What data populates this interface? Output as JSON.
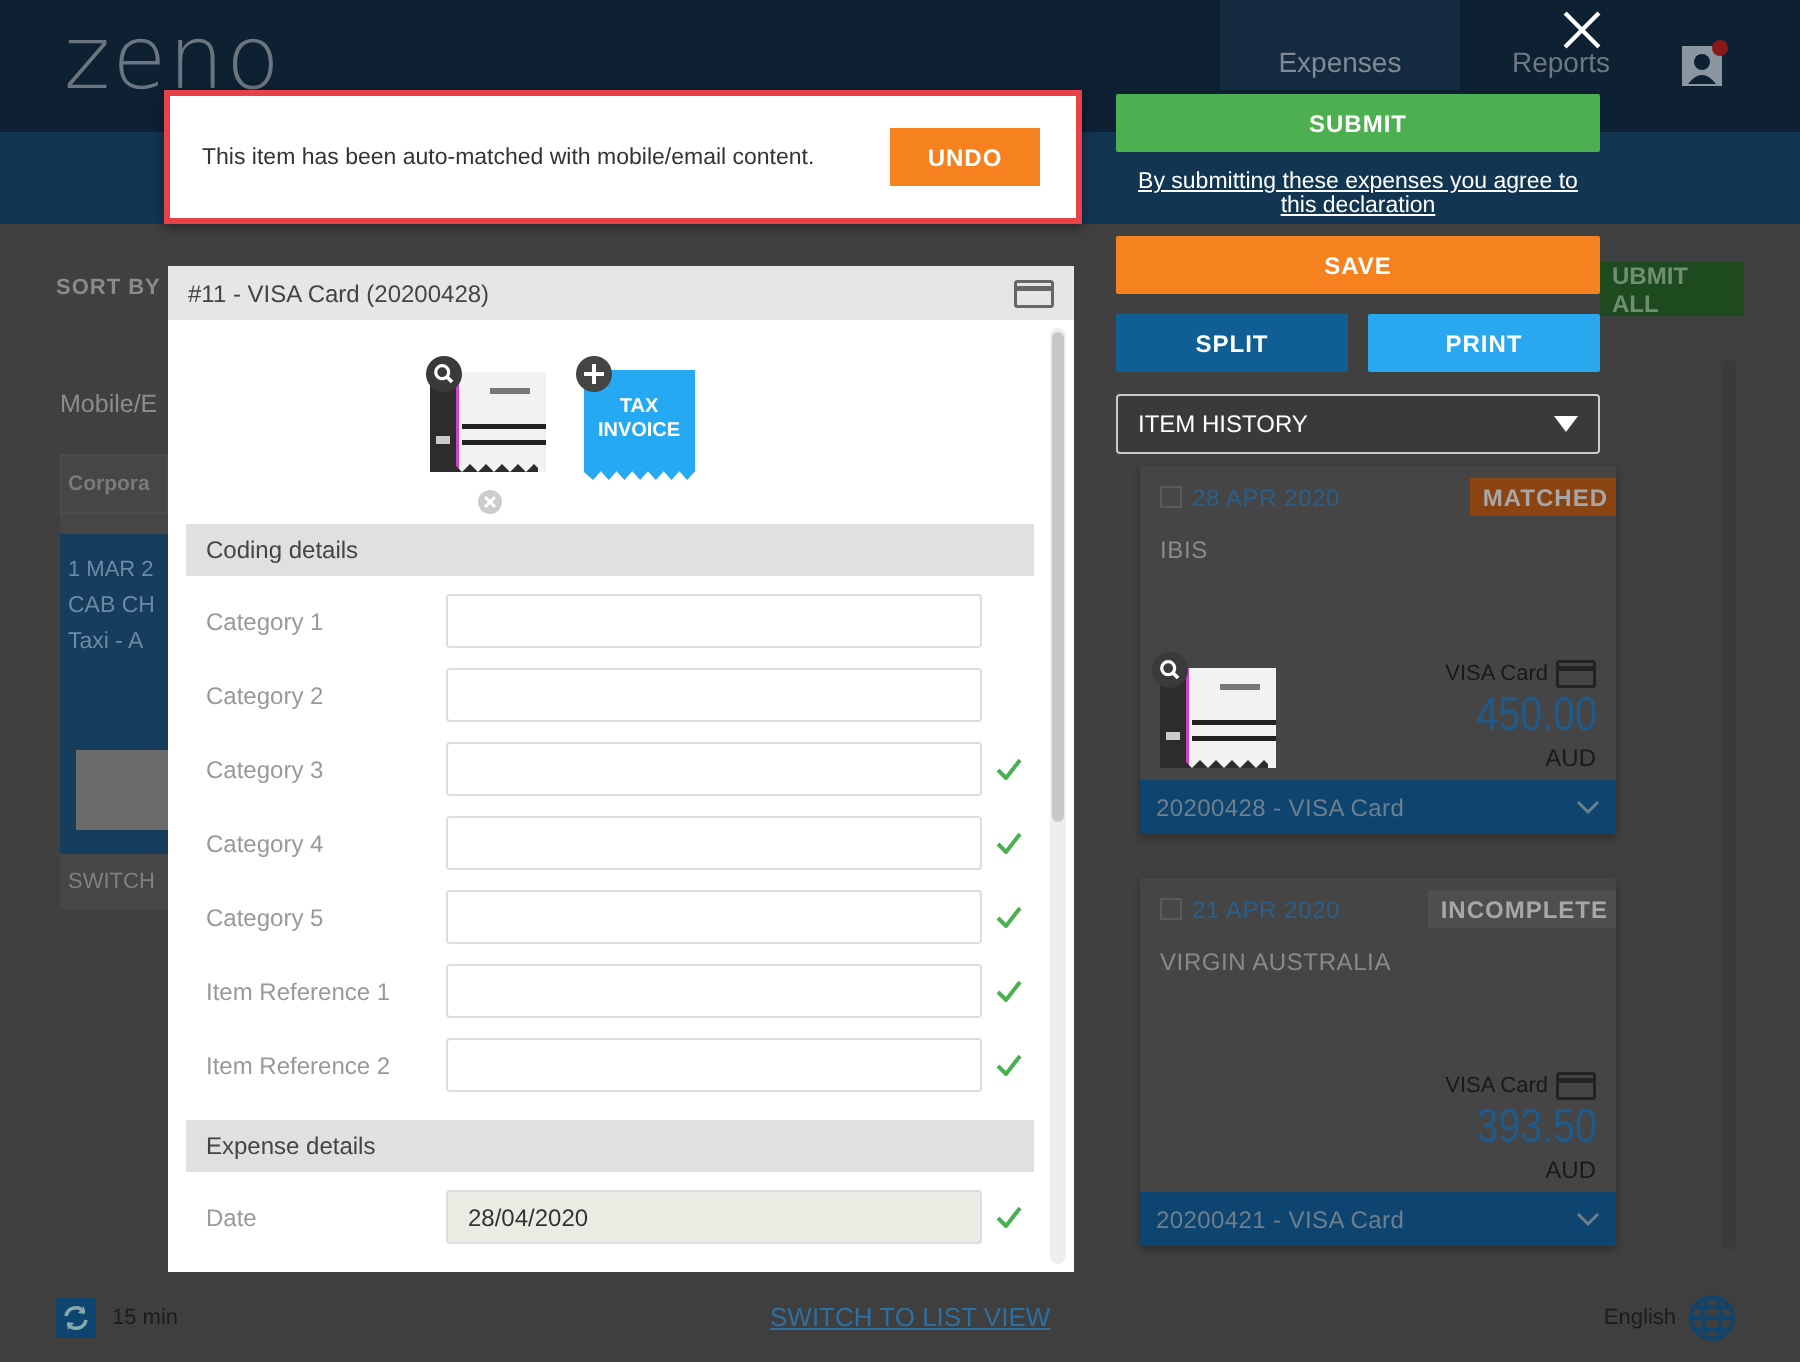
{
  "header": {
    "logo": "zeno",
    "tabs": [
      {
        "label": "Expenses",
        "selected": true
      },
      {
        "label": "Reports",
        "selected": false
      }
    ]
  },
  "background": {
    "sort_label": "SORT BY",
    "submit_all": "UBMIT ALL",
    "group_title": "Mobile/E",
    "left_card": {
      "header": "Corpora",
      "date": "1 MAR 2",
      "merchant": "CAB CH",
      "category": "Taxi - A",
      "footer": "SWITCH"
    },
    "cards": [
      {
        "checked": false,
        "date": "28 APR 2020",
        "status": "MATCHED",
        "color": "#8a4412",
        "merchant": "IBIS",
        "has_receipt": true,
        "payment": "VISA Card",
        "amount": "450.00",
        "currency": "AUD",
        "reference": "20200428 - VISA Card"
      },
      {
        "checked": false,
        "date": "21 APR 2020",
        "status": "INCOMPLETE",
        "color": "#4e4e4e",
        "merchant": "VIRGIN AUSTRALIA",
        "has_receipt": false,
        "payment": "VISA Card",
        "amount": "393.50",
        "currency": "AUD",
        "reference": "20200421 - VISA Card"
      }
    ]
  },
  "notification": {
    "message": "This item has been auto-matched with mobile/email content.",
    "button": "UNDO"
  },
  "actions": {
    "submit": "SUBMIT",
    "declaration": "By submitting these expenses you agree to this declaration",
    "save": "SAVE",
    "split": "SPLIT",
    "print": "PRINT",
    "history": "ITEM HISTORY"
  },
  "modal": {
    "title": "#11 - VISA Card (20200428)",
    "attachments": [
      {
        "kind": "receipt"
      },
      {
        "kind": "placeholder",
        "label": "TAX INVOICE"
      }
    ],
    "sections": [
      {
        "title": "Coding details",
        "fields": [
          {
            "label": "Category 1",
            "valid": false,
            "readonly": false
          },
          {
            "label": "Category 2",
            "valid": false,
            "readonly": false
          },
          {
            "label": "Category 3",
            "valid": true,
            "readonly": false
          },
          {
            "label": "Category 4",
            "valid": true,
            "readonly": false
          },
          {
            "label": "Category 5",
            "valid": true,
            "readonly": false
          },
          {
            "label": "Item Reference 1",
            "valid": true,
            "readonly": false
          },
          {
            "label": "Item Reference 2",
            "valid": true,
            "readonly": false
          }
        ]
      },
      {
        "title": "Expense details",
        "fields": [
          {
            "label": "Date",
            "value": "28/04/2020",
            "valid": true,
            "readonly": true
          }
        ]
      }
    ]
  },
  "footer": {
    "refresh": "15 min",
    "link": "SWITCH TO LIST VIEW",
    "language": "English"
  }
}
